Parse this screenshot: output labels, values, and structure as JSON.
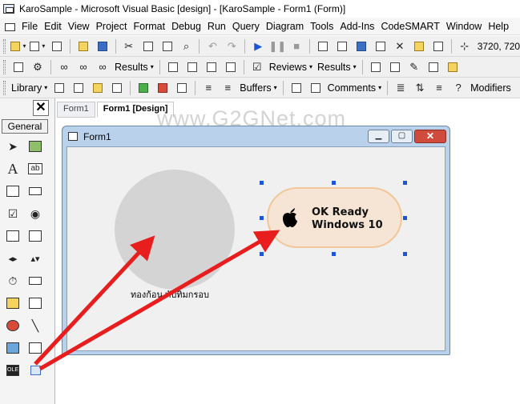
{
  "window": {
    "title": "KaroSample - Microsoft Visual Basic [design] - [KaroSample - Form1 (Form)]"
  },
  "menu": [
    "File",
    "Edit",
    "View",
    "Project",
    "Format",
    "Debug",
    "Run",
    "Query",
    "Diagram",
    "Tools",
    "Add-Ins",
    "CodeSMART",
    "Window",
    "Help"
  ],
  "toolbar1": {
    "coords": "3720, 720"
  },
  "toolbar2": {
    "results": "Results",
    "reviews": "Reviews",
    "results2": "Results"
  },
  "toolbar3": {
    "library": "Library",
    "buffers": "Buffers",
    "comments": "Comments",
    "modifiers": "Modifiers"
  },
  "toolbox": {
    "close": "✕",
    "general": "General"
  },
  "tabs": [
    "Form1",
    "Form1 [Design]"
  ],
  "watermark": "www.G2GNet.com",
  "form": {
    "title": "Form1",
    "circle_caption": "ทองก้อน ทับทิมกรอบ",
    "ok_button": {
      "line1": "OK Ready",
      "line2": "Windows 10"
    }
  },
  "colors": {
    "arrow": "#e81d1d",
    "handle": "#1d55d6",
    "ok_fill": "#f6e4d4",
    "ok_border": "#f1c79a",
    "circle": "#d4d4d4"
  }
}
